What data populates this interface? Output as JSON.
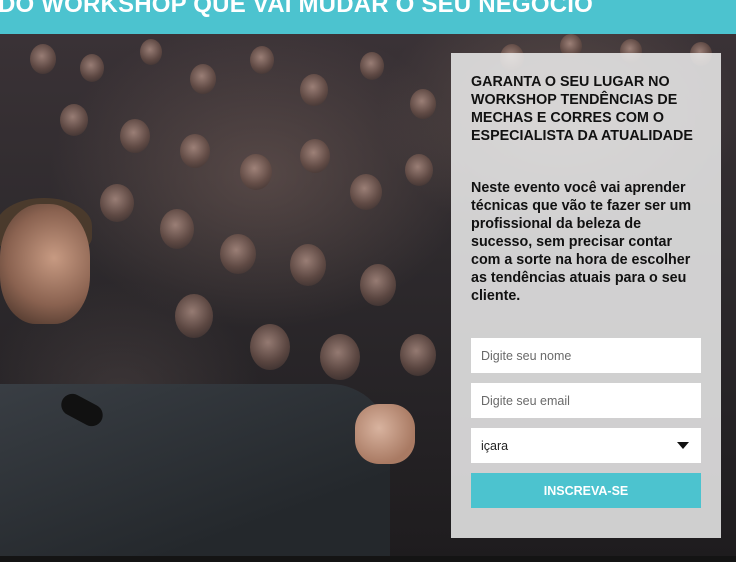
{
  "banner": {
    "headline": "DO WORKSHOP QUE VAI MUDAR O SEU NEGÓCIO"
  },
  "form": {
    "title": "GARANTA O SEU LUGAR NO WORKSHOP TENDÊNCIAS DE MECHAS E CORRES COM O ESPECIALISTA DA ATUALIDADE",
    "description": "Neste evento você vai aprender técnicas que vão te fazer ser um profissional da beleza de sucesso, sem precisar contar com a sorte na hora de escolher as tendências atuais para o seu cliente.",
    "name_placeholder": "Digite seu nome",
    "email_placeholder": "Digite seu email",
    "city_selected": "içara",
    "submit_label": "INSCREVA-SE"
  },
  "colors": {
    "accent": "#4cc3cf",
    "panel": "#ececec"
  },
  "icons": {
    "select_caret": "chevron-down-icon"
  }
}
